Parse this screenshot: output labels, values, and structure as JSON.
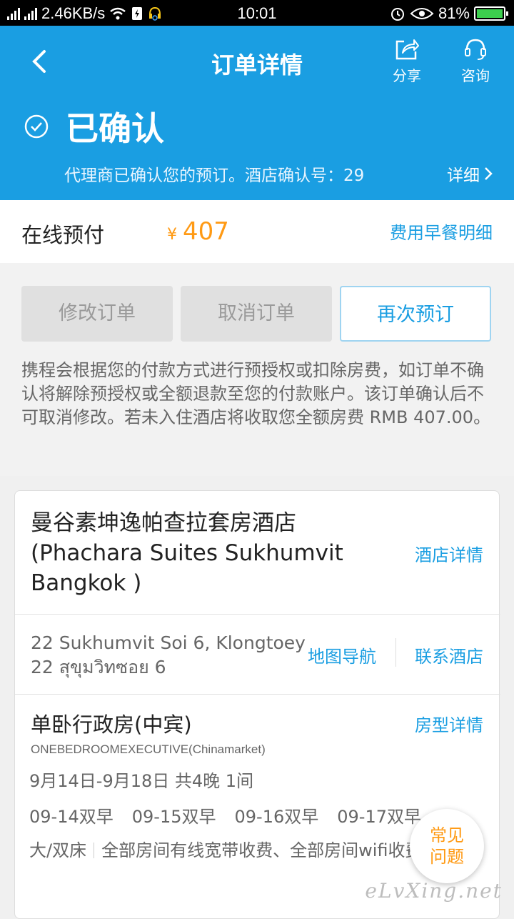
{
  "status_bar": {
    "network_speed": "2.46KB/s",
    "time": "10:01",
    "battery_percent": "81%",
    "icons": [
      "signal-icon",
      "wifi-icon",
      "sim-icon",
      "headset-icon",
      "alarm-icon",
      "eye-icon",
      "battery-icon"
    ]
  },
  "header": {
    "title": "订单详情",
    "share_label": "分享",
    "consult_label": "咨询",
    "status": "已确认",
    "subtitle": "代理商已确认您的预订。酒店确认号：29",
    "detail_link": "详细"
  },
  "payment": {
    "label": "在线预付",
    "currency": "¥",
    "amount": "407",
    "fee_link": "费用早餐明细"
  },
  "actions": {
    "modify": "修改订单",
    "cancel": "取消订单",
    "rebook": "再次预订",
    "notice": "携程会根据您的付款方式进行预授权或扣除房费，如订单不确认将解除预授权或全额退款至您的付款账户。该订单确认后不可取消修改。若未入住酒店将收取您全额房费 RMB 407.00。"
  },
  "hotel": {
    "name": "曼谷素坤逸帕查拉套房酒店 (Phachara Suites Sukhumvit Bangkok )",
    "detail_link": "酒店详情",
    "address_line1": "22 Sukhumvit Soi 6, Klongtoey",
    "address_line2": "22 สุขุมวิทซอย 6",
    "map_link": "地图导航",
    "contact_link": "联系酒店"
  },
  "room": {
    "name": "单卧行政房(中宾)",
    "detail_link": "房型详情",
    "name_en": "ONEBEDROOMEXECUTIVE(Chinamarket)",
    "dates": "9月14日-9月18日 共4晚 1间",
    "meals": [
      "09-14双早",
      "09-15双早",
      "09-16双早",
      "09-17双早"
    ],
    "bed": "大/双床",
    "broadband": "全部房间有线宽带收费、全部房间wifi收费"
  },
  "faq": {
    "line1": "常见",
    "line2": "问题"
  },
  "watermark": "eLvXing.net",
  "colors": {
    "primary": "#1a9ee2",
    "price": "#ff9a14",
    "disabled_bg": "#e0e0e0"
  }
}
